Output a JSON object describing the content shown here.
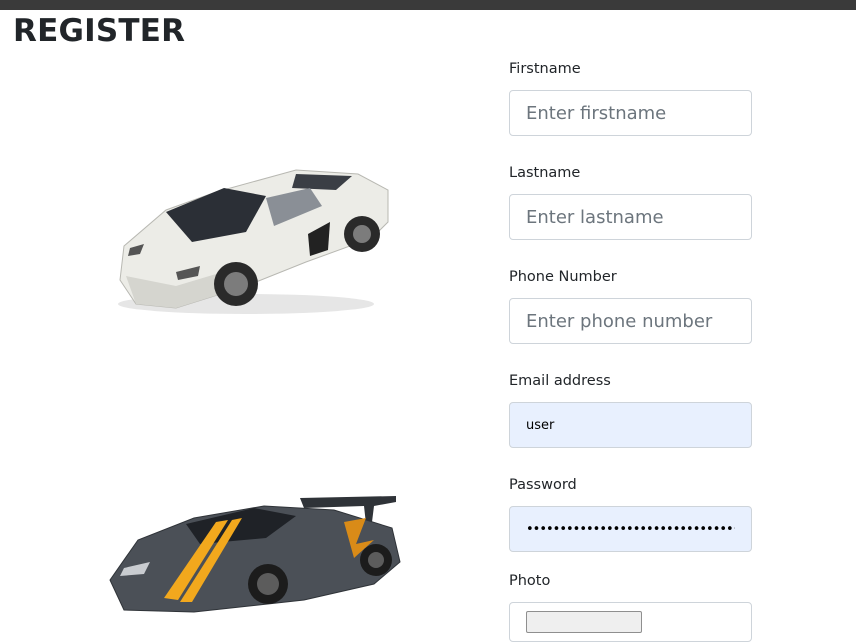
{
  "page": {
    "title": "REGISTER"
  },
  "images": [
    {
      "name": "white-sports-car",
      "color": "#e9e9e4"
    },
    {
      "name": "grey-sports-car-orange-stripes",
      "color": "#4a4f55",
      "accent": "#f2a81d"
    }
  ],
  "form": {
    "firstname": {
      "label": "Firstname",
      "placeholder": "Enter firstname",
      "value": ""
    },
    "lastname": {
      "label": "Lastname",
      "placeholder": "Enter lastname",
      "value": ""
    },
    "phone": {
      "label": "Phone Number",
      "placeholder": "Enter phone number",
      "value": ""
    },
    "email": {
      "label": "Email address",
      "value": "user"
    },
    "password": {
      "label": "Password",
      "value": "••••••••••••••••••••••••••••••••••"
    },
    "photo": {
      "label": "Photo"
    }
  },
  "colors": {
    "autofill_bg": "#e8f0fe",
    "border": "#ced4da",
    "topbar": "#3a3a3a",
    "stripe": "#f2a81d"
  }
}
